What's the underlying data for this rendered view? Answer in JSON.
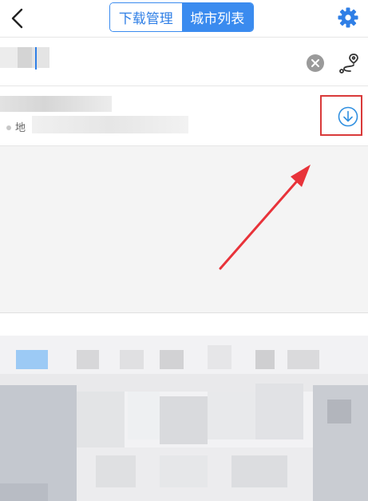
{
  "header": {
    "back_icon": "chevron-left-icon",
    "tabs": [
      {
        "label": "下载管理",
        "selected": false
      },
      {
        "label": "城市列表",
        "selected": true
      }
    ],
    "settings_icon": "gear-icon",
    "accent": "#3a8bef"
  },
  "search": {
    "clear_icon": "clear-icon",
    "route_icon": "route-icon"
  },
  "result": {
    "address_prefix": "地",
    "download_icon": "download-icon",
    "highlight_color": "#d93a3a"
  },
  "annotation": {
    "arrow_color": "#e8333a"
  }
}
